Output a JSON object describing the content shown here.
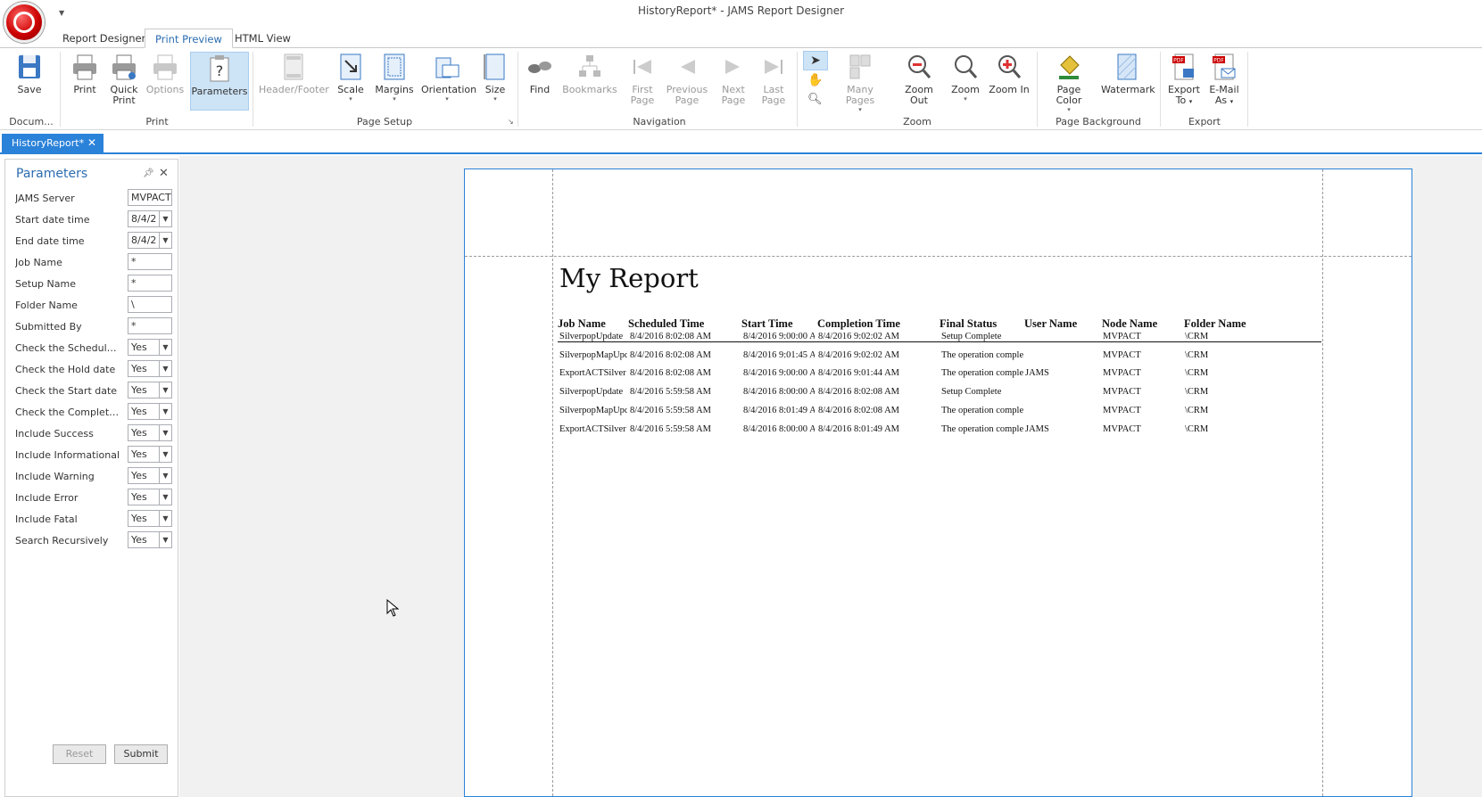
{
  "window": {
    "title": "HistoryReport* - JAMS Report Designer"
  },
  "tabs": [
    {
      "label": "Report Designer"
    },
    {
      "label": "Print Preview"
    },
    {
      "label": "HTML View"
    }
  ],
  "ribbon": {
    "document": {
      "save": "Save",
      "group": "Docum..."
    },
    "print": {
      "print": "Print",
      "quick_print_1": "Quick",
      "quick_print_2": "Print",
      "options": "Options",
      "parameters": "Parameters",
      "group": "Print"
    },
    "page_setup": {
      "header_footer": "Header/Footer",
      "scale": "Scale",
      "margins": "Margins",
      "orientation": "Orientation",
      "size": "Size",
      "group": "Page Setup"
    },
    "navigation": {
      "find": "Find",
      "bookmarks": "Bookmarks",
      "first_1": "First",
      "first_2": "Page",
      "prev_1": "Previous",
      "prev_2": "Page",
      "next_1": "Next",
      "next_2": "Page",
      "last_1": "Last",
      "last_2": "Page",
      "group": "Navigation"
    },
    "zoom": {
      "many_pages": "Many Pages",
      "zoom_out": "Zoom Out",
      "zoom": "Zoom",
      "zoom_in": "Zoom In",
      "group": "Zoom"
    },
    "page_background": {
      "page_color": "Page Color",
      "watermark": "Watermark",
      "group": "Page Background"
    },
    "export": {
      "export_1": "Export",
      "export_2": "To",
      "email_1": "E-Mail",
      "email_2": "As",
      "group": "Export"
    }
  },
  "document_tab": {
    "label": "HistoryReport*"
  },
  "parameters": {
    "title": "Parameters",
    "fields": [
      {
        "label": "JAMS Server",
        "value": "MVPACT",
        "kind": "text"
      },
      {
        "label": "Start date  time",
        "value": "8/4/2",
        "kind": "select"
      },
      {
        "label": "End date  time",
        "value": "8/4/2",
        "kind": "select"
      },
      {
        "label": "Job Name",
        "value": "*",
        "kind": "text"
      },
      {
        "label": "Setup Name",
        "value": "*",
        "kind": "text"
      },
      {
        "label": "Folder Name",
        "value": "\\",
        "kind": "text"
      },
      {
        "label": "Submitted By",
        "value": "*",
        "kind": "text"
      },
      {
        "label": "Check the Scheduled ...",
        "value": "Yes",
        "kind": "select"
      },
      {
        "label": "Check the Hold date",
        "value": "Yes",
        "kind": "select"
      },
      {
        "label": "Check the Start date",
        "value": "Yes",
        "kind": "select"
      },
      {
        "label": "Check the Completion...",
        "value": "Yes",
        "kind": "select"
      },
      {
        "label": "Include Success",
        "value": "Yes",
        "kind": "select"
      },
      {
        "label": "Include Informational",
        "value": "Yes",
        "kind": "select"
      },
      {
        "label": "Include Warning",
        "value": "Yes",
        "kind": "select"
      },
      {
        "label": "Include Error",
        "value": "Yes",
        "kind": "select"
      },
      {
        "label": "Include Fatal",
        "value": "Yes",
        "kind": "select"
      },
      {
        "label": "Search Recursively",
        "value": "Yes",
        "kind": "select"
      }
    ],
    "reset_label": "Reset",
    "submit_label": "Submit"
  },
  "report": {
    "title": "My Report",
    "columns": [
      "Job Name",
      "Scheduled Time",
      "Start Time",
      "Completion Time",
      "Final Status",
      "User Name",
      "Node Name",
      "Folder Name"
    ],
    "rows": [
      [
        "SilverpopUpdate",
        "8/4/2016 8:02:08 AM",
        "8/4/2016 9:00:00 A",
        "8/4/2016 9:02:02 AM",
        "Setup Complete",
        "",
        "MVPACT",
        "\\CRM"
      ],
      [
        "SilverpopMapUpd",
        "8/4/2016 8:02:08 AM",
        "8/4/2016 9:01:45 A",
        "8/4/2016 9:02:02 AM",
        "The operation comple",
        "",
        "MVPACT",
        "\\CRM"
      ],
      [
        "ExportACTSilver",
        "8/4/2016 8:02:08 AM",
        "8/4/2016 9:00:00 A",
        "8/4/2016 9:01:44 AM",
        "The operation comple",
        "JAMS",
        "MVPACT",
        "\\CRM"
      ],
      [
        "SilverpopUpdate",
        "8/4/2016 5:59:58 AM",
        "8/4/2016 8:00:00 A",
        "8/4/2016 8:02:08 AM",
        "Setup Complete",
        "",
        "MVPACT",
        "\\CRM"
      ],
      [
        "SilverpopMapUpd",
        "8/4/2016 5:59:58 AM",
        "8/4/2016 8:01:49 A",
        "8/4/2016 8:02:08 AM",
        "The operation comple",
        "",
        "MVPACT",
        "\\CRM"
      ],
      [
        "ExportACTSilver",
        "8/4/2016 5:59:58 AM",
        "8/4/2016 8:00:00 A",
        "8/4/2016 8:01:49 AM",
        "The operation comple",
        "JAMS",
        "MVPACT",
        "\\CRM"
      ]
    ]
  },
  "colors": {
    "accent": "#2b82d9",
    "link": "#2b6cb0",
    "active_button": "#cde3f6"
  }
}
